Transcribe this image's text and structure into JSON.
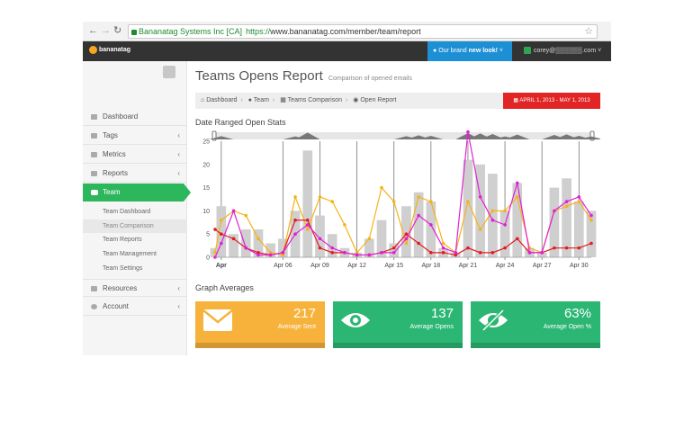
{
  "browser": {
    "ev_org": "Bananatag Systems Inc [CA]",
    "url_scheme": "https://",
    "url_rest": "www.bananatag.com/member/team/report"
  },
  "appbar": {
    "logo_text": "bananatag",
    "brand_msg_pre": "Our brand ",
    "brand_msg_bold": "new look!",
    "user_email": "corey@▒▒▒▒▒▒.com"
  },
  "sidebar": {
    "items": [
      {
        "label": "Dashboard",
        "icon": "home-icon"
      },
      {
        "label": "Tags",
        "icon": "tag-icon"
      },
      {
        "label": "Metrics",
        "icon": "metrics-icon"
      },
      {
        "label": "Reports",
        "icon": "reports-icon"
      },
      {
        "label": "Team",
        "icon": "users-icon"
      },
      {
        "label": "Resources",
        "icon": "resources-icon"
      },
      {
        "label": "Account",
        "icon": "gear-icon"
      }
    ],
    "team_sub": [
      "Team Dashboard",
      "Team Comparison",
      "Team Reports",
      "Team Management",
      "Team Settings"
    ]
  },
  "page": {
    "title": "Teams Opens Report",
    "subtitle": "Comparison of opened emails",
    "breadcrumb": [
      "Dashboard",
      "Team",
      "Teams Comparison",
      "Open Report"
    ],
    "date_range": "APRIL 1, 2013 - MAY 1, 2013",
    "section1": "Date Ranged Open Stats",
    "section2": "Graph Averages"
  },
  "cards": [
    {
      "value": "217",
      "label": "Average Sent",
      "color": "#f7b23b",
      "icon": "envelope-icon"
    },
    {
      "value": "137",
      "label": "Average Opens",
      "color": "#2cb673",
      "icon": "eye-icon"
    },
    {
      "value": "63%",
      "label": "Average Open %",
      "color": "#2cb673",
      "icon": "eye-slash-icon"
    }
  ],
  "chart_data": {
    "type": "bar",
    "ylim": [
      0,
      25
    ],
    "yticks": [
      "0",
      "5",
      "10",
      "15",
      "20",
      "25"
    ],
    "xticks": [
      {
        "label": "Apr",
        "day": 1
      },
      {
        "label": "Apr 06",
        "day": 6
      },
      {
        "label": "Apr 09",
        "day": 9
      },
      {
        "label": "Apr 12",
        "day": 12
      },
      {
        "label": "Apr 15",
        "day": 15
      },
      {
        "label": "Apr 18",
        "day": 18
      },
      {
        "label": "Apr 21",
        "day": 21
      },
      {
        "label": "Apr 24",
        "day": 24
      },
      {
        "label": "Apr 27",
        "day": 27
      },
      {
        "label": "Apr 30",
        "day": 30
      }
    ],
    "days": [
      0.5,
      1,
      2,
      3,
      4,
      5,
      6,
      7,
      8,
      9,
      10,
      11,
      12,
      13,
      14,
      15,
      16,
      17,
      18,
      19,
      20,
      21,
      22,
      23,
      24,
      25,
      26,
      27,
      28,
      29,
      30,
      31
    ],
    "bars": [
      2,
      11,
      5,
      6,
      6,
      3,
      4,
      10,
      23,
      9,
      5,
      2,
      1,
      4,
      8,
      3,
      11,
      14,
      12,
      2,
      1,
      21,
      20,
      18,
      10,
      16,
      2,
      1,
      15,
      17,
      12,
      10
    ],
    "series": [
      {
        "color": "#f5b31a",
        "values": [
          1,
          8,
          10,
          9,
          4,
          1,
          0.5,
          13,
          6,
          13,
          12,
          7,
          1,
          4,
          15,
          12,
          3,
          13,
          12,
          3,
          1,
          12,
          6,
          10,
          10,
          13,
          2,
          1,
          10,
          11,
          12,
          8
        ]
      },
      {
        "color": "#e31b23",
        "values": [
          6,
          5,
          4,
          2,
          1,
          0.5,
          1,
          8,
          8,
          2,
          1,
          1,
          0.5,
          0.5,
          1,
          2,
          5,
          3,
          1,
          1,
          0.5,
          2,
          1,
          1,
          2,
          4,
          1,
          1,
          2,
          2,
          2,
          3
        ]
      },
      {
        "color": "#e21fd6",
        "values": [
          0,
          3,
          10,
          2,
          0.5,
          0.5,
          1,
          5,
          7,
          4,
          2,
          1,
          0.5,
          0.5,
          1,
          1,
          4,
          9,
          7,
          2,
          1,
          27,
          13,
          8,
          7,
          16,
          1,
          1,
          10,
          12,
          13,
          9
        ]
      }
    ]
  }
}
